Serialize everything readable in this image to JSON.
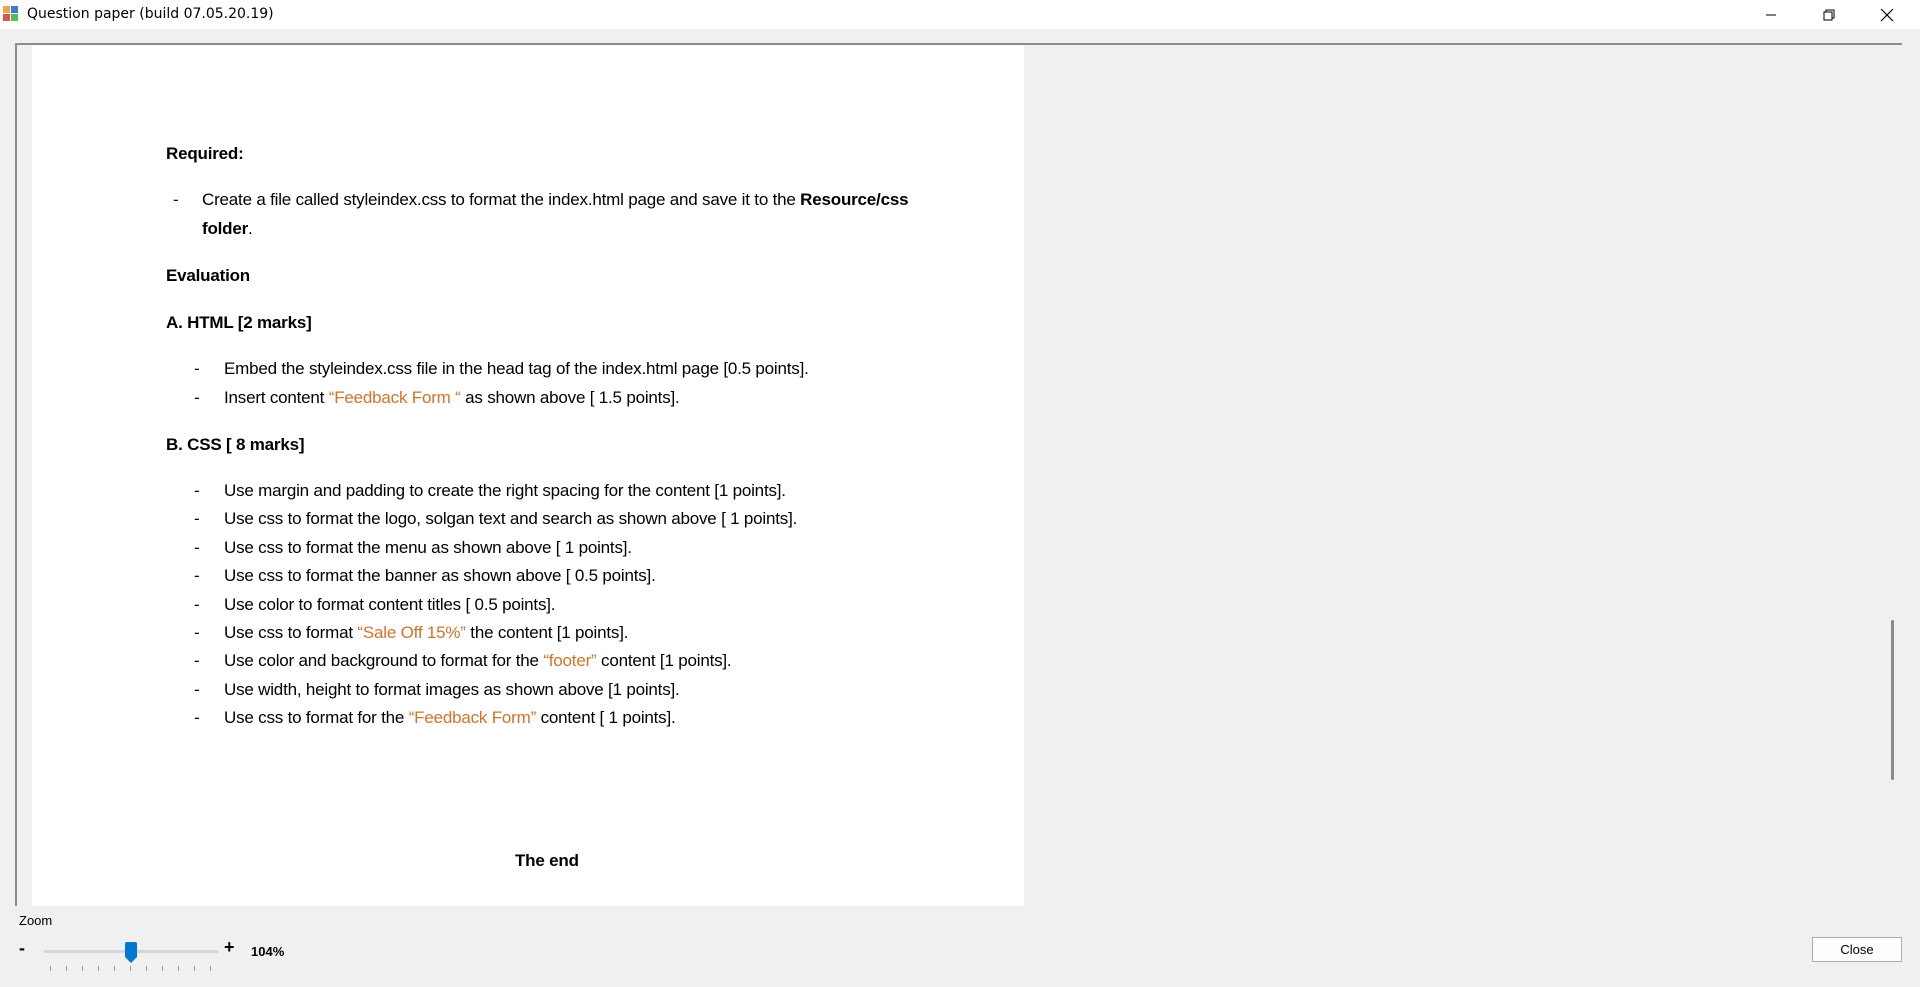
{
  "window": {
    "title": "Question paper (build 07.05.20.19)"
  },
  "document": {
    "required_heading": "Required:",
    "required_item": {
      "bullet": "-",
      "text_prefix": "Create a file called styleindex.css to format the index.html page and save it to the ",
      "bold_part": "Resource/css",
      "line2_bold": "folder",
      "line2_end": "."
    },
    "evaluation_heading": "Evaluation",
    "section_a": {
      "heading": "A. HTML  [2 marks]",
      "items": [
        {
          "pre": "Embed the styleindex.css file in the head tag of the index.html page [0.5 points].",
          "hl": "",
          "post": ""
        },
        {
          "pre": "Insert content ",
          "hl": "“Feedback Form “",
          "post": "  as shown above [ 1.5 points]."
        }
      ]
    },
    "section_b": {
      "heading": "B. CSS  [ 8 marks]",
      "items": [
        {
          "pre": "Use margin and padding to create the right spacing for the content [1 points].",
          "hl": "",
          "post": ""
        },
        {
          "pre": "Use css to format the logo, solgan text and search as shown above [ 1 points].",
          "hl": "",
          "post": ""
        },
        {
          "pre": "Use css to format the menu as shown above [ 1 points].",
          "hl": "",
          "post": ""
        },
        {
          "pre": "Use css to format the banner as shown above [ 0.5 points].",
          "hl": "",
          "post": ""
        },
        {
          "pre": "Use color to format content titles [ 0.5 points].",
          "hl": "",
          "post": ""
        },
        {
          "pre": "Use css to format ",
          "hl": "“Sale Off 15%”",
          "post": " the content [1 points]."
        },
        {
          "pre": "Use color and background  to format for the ",
          "hl": "“footer”",
          "post": " content [1 points]."
        },
        {
          "pre": "Use width, height to format images as shown above [1 points].",
          "hl": "",
          "post": ""
        },
        {
          "pre": "Use css to format for the ",
          "hl": "“Feedback Form”",
          "post": " content [ 1 points]."
        }
      ]
    },
    "end_text": "The end"
  },
  "zoom": {
    "label": "Zoom",
    "minus": "-",
    "plus": "+",
    "value": "104%",
    "slider_fraction": 0.5
  },
  "buttons": {
    "close": "Close"
  },
  "colors": {
    "highlight": "#d0742a",
    "slider_thumb": "#0078d4"
  }
}
